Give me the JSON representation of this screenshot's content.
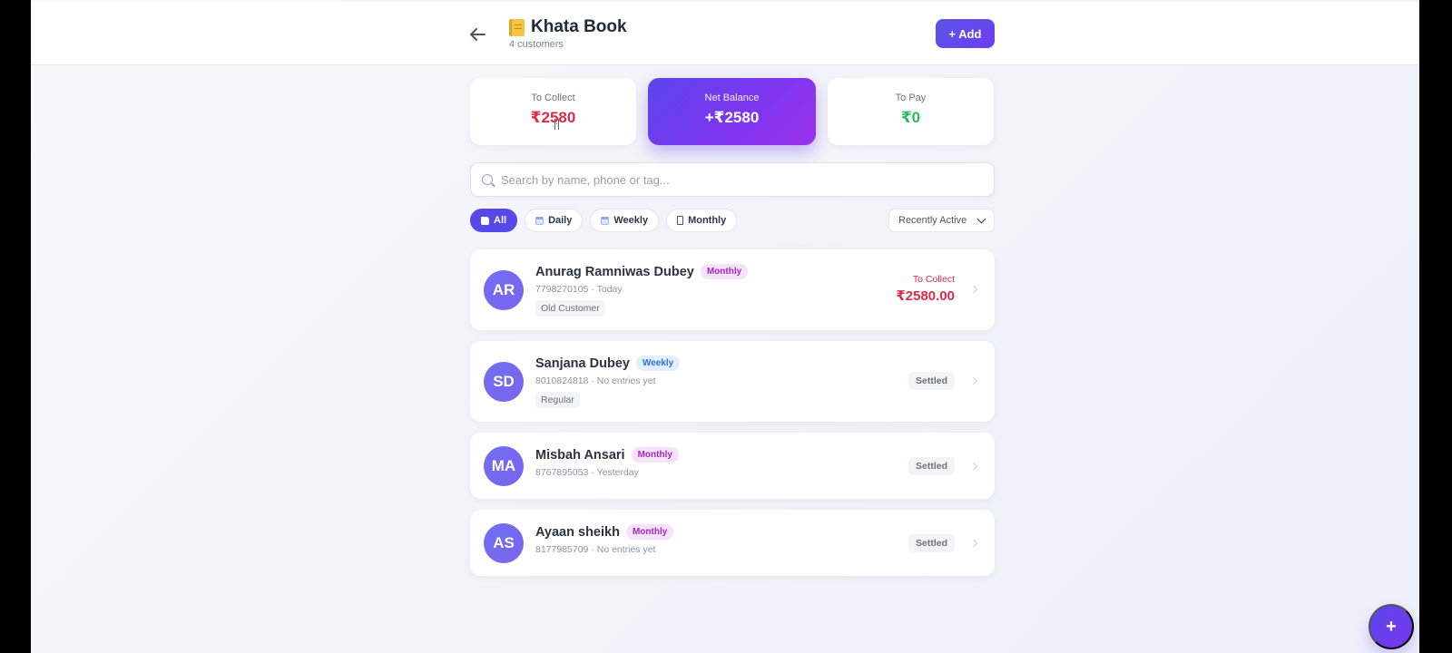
{
  "header": {
    "title": "Khata Book",
    "subtitle": "4 customers",
    "add_label": "+ Add",
    "icons": {
      "back": "arrow-left-icon",
      "notebook": "notebook-icon"
    }
  },
  "stats": {
    "to_collect_label": "To Collect",
    "to_collect_value": "₹2580",
    "net_balance_label": "Net Balance",
    "net_balance_value": "+₹2580",
    "to_pay_label": "To Pay",
    "to_pay_value": "₹0"
  },
  "search": {
    "placeholder": "Search by name, phone or tag...",
    "value": ""
  },
  "filters": [
    {
      "label": "All",
      "active": true,
      "icon": "folder-icon"
    },
    {
      "label": "Daily",
      "active": false,
      "icon": "calendar-icon"
    },
    {
      "label": "Weekly",
      "active": false,
      "icon": "calendar-icon"
    },
    {
      "label": "Monthly",
      "active": false,
      "icon": "document-icon"
    }
  ],
  "sort": {
    "selected": "Recently Active"
  },
  "customers": [
    {
      "initials": "AR",
      "name": "Anurag Ramniwas Dubey",
      "frequency": "Monthly",
      "phone": "7798270105",
      "activity": "Today",
      "tag": "Old Customer",
      "status_label": "To Collect",
      "amount": "₹2580.00"
    },
    {
      "initials": "SD",
      "name": "Sanjana Dubey",
      "frequency": "Weekly",
      "phone": "8010824818",
      "activity": "No entries yet",
      "tag": "Regular",
      "status": "Settled"
    },
    {
      "initials": "MA",
      "name": "Misbah Ansari",
      "frequency": "Monthly",
      "phone": "8767895053",
      "activity": "Yesterday",
      "status": "Settled"
    },
    {
      "initials": "AS",
      "name": "Ayaan sheikh",
      "frequency": "Monthly",
      "phone": "8177985709",
      "activity": "No entries yet",
      "status": "Settled"
    }
  ],
  "fab": {
    "label": "+"
  },
  "colors": {
    "accent": "#5549E9",
    "collect": "#DC2B47",
    "pay": "#2FBA5D",
    "monthly_badge": "#A626C1",
    "weekly_badge": "#2D6FD7"
  }
}
